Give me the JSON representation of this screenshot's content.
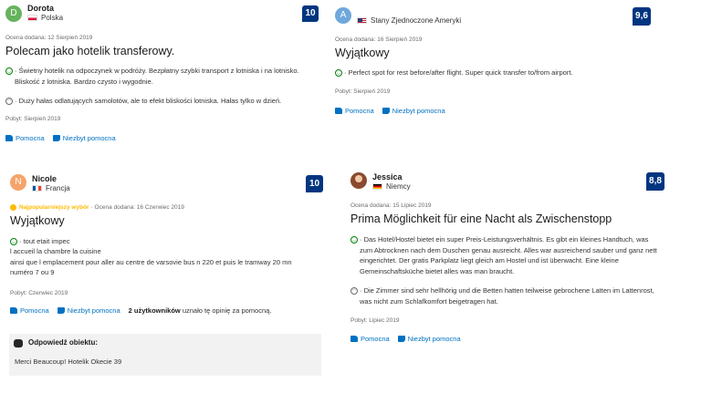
{
  "reviews": [
    {
      "avatar_letter": "D",
      "avatar_color": "#66b25d",
      "name": "Dorota",
      "country": "Polska",
      "flag": "flag-pl",
      "score": "10",
      "date": "Ocena dodana: 12 Sierpień 2019",
      "title": "Polecam jako hotelik transferowy.",
      "positive": "· Świetny hotelik na odpoczynek w podróży. Bezpłatny szybki transport z lotniska i na lotnisko. Bliskość z lotniska. Bardzo czysto i wygodnie.",
      "negative": "· Duży hałas odlatujących samolotów, ale to efekt bliskości lotniska. Hałas tylko w dzień.",
      "stay": "Pobyt: Sierpień 2019",
      "helpful": "Pomocna",
      "not_helpful": "Niezbyt pomocna"
    },
    {
      "avatar_letter": "A",
      "avatar_color": "#6fa8dc",
      "name": "",
      "country": "Stany Zjednoczone Ameryki",
      "flag": "flag-us",
      "score": "9,6",
      "date": "Ocena dodana: 16 Sierpień 2019",
      "title": "Wyjątkowy",
      "positive": "· Perfect spot for rest before/after flight. Super quick transfer to/from airport.",
      "stay": "Pobyt: Sierpień 2019",
      "helpful": "Pomocna",
      "not_helpful": "Niezbyt pomocna"
    },
    {
      "avatar_letter": "N",
      "avatar_color": "#f5a46b",
      "name": "Nicole",
      "country": "Francja",
      "flag": "flag-fr",
      "score": "10",
      "badge_label": "Najpopularniejszy wybór",
      "date": "· Ocena dodana: 16 Czerwiec 2019",
      "title": "Wyjątkowy",
      "positive_lines": [
        "· tout etait impec",
        "l accueil la chambre la cuisine",
        "ainsi que l emplacement pour aller au centre de varsovie bus n 220 et puis le tramway 20 mn",
        "numéro 7 ou 9"
      ],
      "stay": "Pobyt: Czerwiec 2019",
      "helpful": "Pomocna",
      "not_helpful": "Niezbyt pomocna",
      "helped_count": "2 użytkowników",
      "helped_text": " uznało tę opinię za pomocną.",
      "response_title": "Odpowiedź obiektu:",
      "response_text": "Merci Beaucoup! Hotelik Okecie 39"
    },
    {
      "avatar_letter": "",
      "avatar_color": "#8a4a2f",
      "name": "Jessica",
      "country": "Niemcy",
      "flag": "flag-de",
      "score": "8,8",
      "date": "Ocena dodana: 15 Lipiec 2019",
      "title": "Prima Möglichkeit für eine Nacht als Zwischenstopp",
      "positive": "· Das Hotel/Hostel bietet ein super Preis-Leistungsverhältnis. Es gibt ein kleines Handtuch, was zum Abtrocknen nach dem Duschen genau ausreicht. Alles war ausreichend sauber und ganz nett eingerichtet. Der gratis Parkplatz liegt gleich am Hostel und ist überwacht. Eine kleine Gemeinschaftsküche bietet alles was man braucht.",
      "negative": "· Die Zimmer sind sehr hellhörig und die Betten hatten teilweise gebrochene Latten im Lattenrost, was nicht zum Schlafkomfort beigetragen hat.",
      "stay": "Pobyt: Lipiec 2019",
      "helpful": "Pomocna",
      "not_helpful": "Niezbyt pomocna"
    }
  ],
  "colors": {
    "brand": "#003580",
    "link": "#0071c2",
    "positive": "#008009",
    "badge": "#febb02"
  },
  "icons": {
    "positive": "smile-icon",
    "negative": "frown-icon",
    "helpful": "thumbs-up-icon",
    "not_helpful": "thumbs-down-icon",
    "response": "speech-bubble-icon",
    "badge": "trophy-icon"
  }
}
